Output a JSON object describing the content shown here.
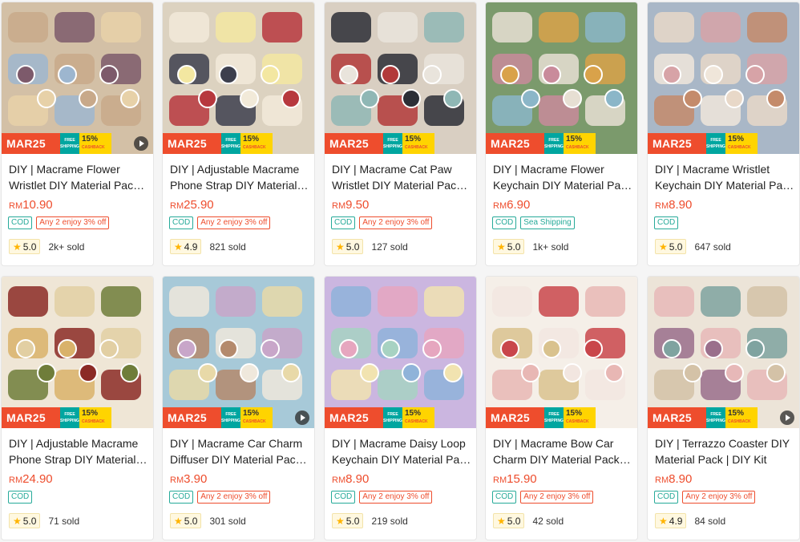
{
  "promo": {
    "badge": "MAR25",
    "ship_line1": "FREE",
    "ship_line2": "SHIPPING",
    "cash_pct": "15%",
    "cash_label": "CASHBACK"
  },
  "colors": {
    "accent": "#ee4d2d",
    "teal": "#26aa99",
    "star": "#ffb400"
  },
  "products": [
    {
      "title": "DIY | Macrame Flower Wristlet DIY Material Pack | DIY Kit",
      "currency": "RM",
      "price": "10.90",
      "tags": [
        "COD",
        "Any 2 enjoy 3% off"
      ],
      "rating": "5.0",
      "sold": "2k+ sold",
      "video": true,
      "palette": [
        "#c8a98a",
        "#7d5a6b",
        "#e7d1a8",
        "#9db6cf",
        "#d3c0a6"
      ]
    },
    {
      "title": "DIY | Adjustable Macrame Phone Strap DIY Material Pack",
      "currency": "RM",
      "price": "25.90",
      "tags": [
        "COD",
        "Any 2 enjoy 3% off"
      ],
      "rating": "4.9",
      "sold": "821 sold",
      "video": false,
      "palette": [
        "#f2ead9",
        "#f3e7a1",
        "#b7383e",
        "#3d3f4d",
        "#dcd2c0"
      ]
    },
    {
      "title": "DIY | Macrame Cat Paw Wristlet DIY Material Pack | DIY Kit",
      "currency": "RM",
      "price": "9.50",
      "tags": [
        "COD",
        "Any 2 enjoy 3% off"
      ],
      "rating": "5.0",
      "sold": "127 sold",
      "video": false,
      "palette": [
        "#2b2e36",
        "#e9e4dc",
        "#8fb7b5",
        "#b23a3a",
        "#d9cfc2"
      ]
    },
    {
      "title": "DIY | Macrame Flower Keychain DIY Material Pack | DIY Kit",
      "currency": "RM",
      "price": "6.90",
      "tags": [
        "COD",
        "Sea Shipping"
      ],
      "rating": "5.0",
      "sold": "1k+ sold",
      "video": false,
      "palette": [
        "#e7dfd3",
        "#d9a24a",
        "#8bb6c8",
        "#c98b9b",
        "#7b9a6c"
      ]
    },
    {
      "title": "DIY | Macrame Wristlet Keychain DIY Material Pack | DIY Kit",
      "currency": "RM",
      "price": "8.90",
      "tags": [
        "COD"
      ],
      "rating": "5.0",
      "sold": "647 sold",
      "video": false,
      "palette": [
        "#e8d8c8",
        "#d7a3a7",
        "#c48b6b",
        "#f0e6da",
        "#a9b7c7"
      ]
    },
    {
      "title": "DIY | Adjustable Macrame Phone Strap DIY Material Pack",
      "currency": "RM",
      "price": "24.90",
      "tags": [
        "COD"
      ],
      "rating": "5.0",
      "sold": "71 sold",
      "video": false,
      "palette": [
        "#8b2a26",
        "#e2cfa3",
        "#6f7d3a",
        "#d9b26a",
        "#efe6d6"
      ]
    },
    {
      "title": "DIY | Macrame Car Charm Diffuser DIY Material Pack | DIY Kit",
      "currency": "RM",
      "price": "3.90",
      "tags": [
        "COD",
        "Any 2 enjoy 3% off"
      ],
      "rating": "5.0",
      "sold": "301 sold",
      "video": true,
      "palette": [
        "#efe8dc",
        "#c8a6c9",
        "#e8d9a8",
        "#b48a6d",
        "#a7c9d8"
      ]
    },
    {
      "title": "DIY | Macrame Daisy Loop Keychain DIY Material Pack | DIY Kit",
      "currency": "RM",
      "price": "8.90",
      "tags": [
        "COD",
        "Any 2 enjoy 3% off"
      ],
      "rating": "5.0",
      "sold": "219 sold",
      "video": false,
      "palette": [
        "#8fb3d9",
        "#e6a6bf",
        "#f1e3b0",
        "#a7d2c2",
        "#cbb6e0"
      ]
    },
    {
      "title": "DIY | Macrame Bow Car Charm DIY Material Pack | DIY Kit",
      "currency": "RM",
      "price": "15.90",
      "tags": [
        "COD",
        "Any 2 enjoy 3% off"
      ],
      "rating": "5.0",
      "sold": "42 sold",
      "video": false,
      "palette": [
        "#f2e6e0",
        "#c9464b",
        "#e8b7b4",
        "#d9c28e",
        "#f5efe8"
      ]
    },
    {
      "title": "DIY | Terrazzo Coaster DIY Material Pack | DIY Kit",
      "currency": "RM",
      "price": "8.90",
      "tags": [
        "COD",
        "Any 2 enjoy 3% off"
      ],
      "rating": "4.9",
      "sold": "84 sold",
      "video": true,
      "palette": [
        "#e7b8b8",
        "#7fa3a0",
        "#d4c2a7",
        "#9a6f8c",
        "#ece4d8"
      ]
    }
  ]
}
